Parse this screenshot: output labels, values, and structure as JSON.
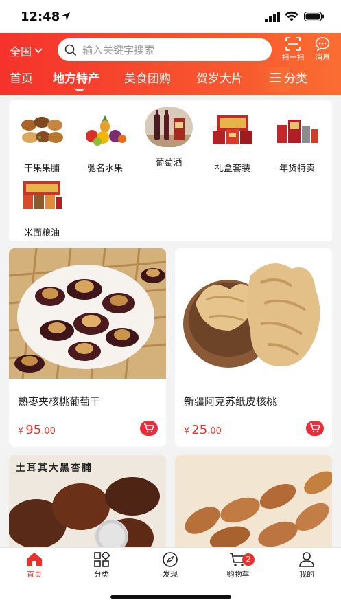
{
  "status": {
    "time": "12:48"
  },
  "header": {
    "region": "全国",
    "search_placeholder": "输入关键字搜索",
    "scan_label": "扫一扫",
    "message_label": "消息"
  },
  "tabs": [
    "首页",
    "地方特产",
    "美食团购",
    "贺岁大片"
  ],
  "tab_more": "分类",
  "categories": [
    {
      "label": "干果果脯"
    },
    {
      "label": "驰名水果"
    },
    {
      "label": "葡萄酒"
    },
    {
      "label": "礼盒套装"
    },
    {
      "label": "年货特卖"
    },
    {
      "label": "米面粮油"
    }
  ],
  "products": [
    {
      "name": "熟枣夹核桃葡萄干",
      "currency": "¥",
      "price_int": "95",
      "price_dec": ".00"
    },
    {
      "name": "新疆阿克苏纸皮核桃",
      "currency": "¥",
      "price_int": "25",
      "price_dec": ".00"
    },
    {
      "name": "",
      "image_text": "土耳其大黑杏脯"
    },
    {
      "name": ""
    }
  ],
  "bottom_nav": [
    {
      "label": "首页",
      "icon": "home-icon"
    },
    {
      "label": "分类",
      "icon": "category-grid-icon"
    },
    {
      "label": "发现",
      "icon": "compass-icon"
    },
    {
      "label": "购物车",
      "icon": "cart-icon",
      "badge": "2"
    },
    {
      "label": "我的",
      "icon": "user-icon"
    }
  ],
  "colors": {
    "accent": "#e8322b",
    "header_start": "#f5322c",
    "header_end": "#fa6d32"
  }
}
